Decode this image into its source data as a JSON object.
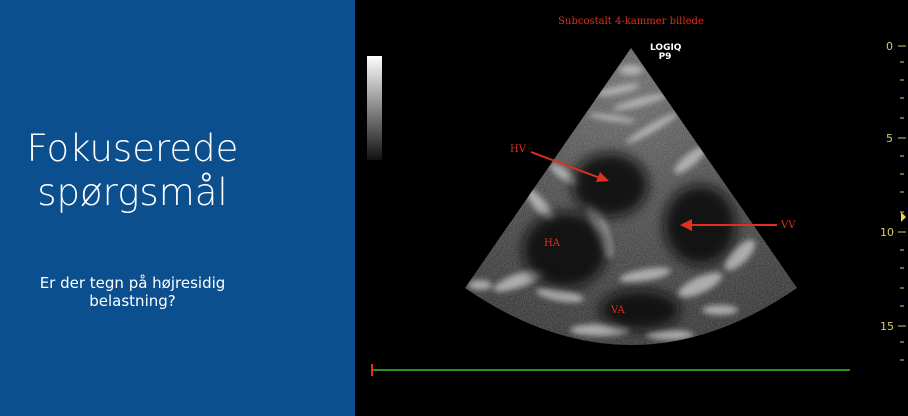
{
  "slide": {
    "title_lines": [
      "Fokuserede",
      "spørgsmål"
    ],
    "question_lines": [
      "Er der tegn på højresidig",
      "belastning?"
    ]
  },
  "ultrasound": {
    "caption": "Subcostalt 4-kammer billede",
    "logo_lines": [
      "LOGIQ",
      "P9"
    ],
    "labels": {
      "hv": "HV",
      "ha": "HA",
      "vv": "VV",
      "va": "VA"
    },
    "depth_ticks": [
      "0",
      "5",
      "10",
      "15"
    ],
    "colors": {
      "label": "#e0301e",
      "ecg_line": "#39c419",
      "depth_scale": "#d8cc6a",
      "slide_background": "#0b4f8f"
    }
  }
}
